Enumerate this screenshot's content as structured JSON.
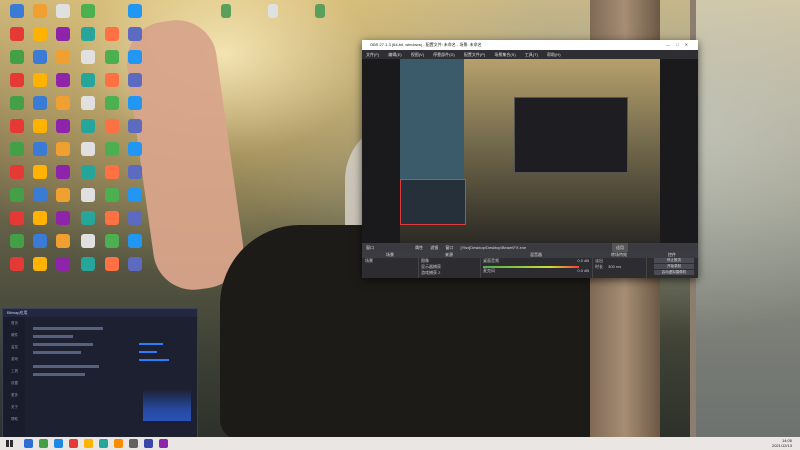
{
  "desktop_icons": [
    {
      "label": "",
      "color": "#3a7bd5"
    },
    {
      "label": "",
      "color": "#f0a030"
    },
    {
      "label": "",
      "color": "#e0e0e0"
    },
    {
      "label": "",
      "color": "#4caf50"
    },
    {
      "label": "",
      "color": "#2196f3"
    },
    {
      "label": "",
      "color": "#e53935"
    },
    {
      "label": "",
      "color": "#ffb300"
    },
    {
      "label": "",
      "color": "#8e24aa"
    },
    {
      "label": "",
      "color": "#26a69a"
    },
    {
      "label": "",
      "color": "#ff7043"
    },
    {
      "label": "",
      "color": "#5c6bc0"
    },
    {
      "label": "",
      "color": "#43a047"
    }
  ],
  "top_files": [
    {
      "label": "",
      "color": "#5aa05a"
    },
    {
      "label": "",
      "color": "#e0e0e0"
    },
    {
      "label": "",
      "color": "#5aa05a"
    }
  ],
  "obs": {
    "title": "OBS 27.1.3 (64-bit, windows) - 配置文件: 未命名 - 场景: 未命名",
    "menu": [
      "文件(F)",
      "编辑(E)",
      "视图(V)",
      "停靠部件(D)",
      "配置文件(P)",
      "场景集合(S)",
      "工具(T)",
      "帮助(H)"
    ],
    "source_bar": {
      "label": "窗口",
      "prop": "属性",
      "filter": "滤镜",
      "window_label": "窗口",
      "window_value": "[Ylsv]Desktop\\Desktop\\Beam\\FX.exe",
      "btn": "适用"
    },
    "panels": {
      "scenes_header": "场景",
      "scenes": [
        "场景"
      ],
      "sources_header": "来源",
      "sources": [
        "图像",
        "显示器捕获",
        "游戏捕获 2"
      ],
      "mixer_header": "混音器",
      "mixer": [
        {
          "name": "桌面音频",
          "value": "0.0 dB"
        },
        {
          "name": "麦克风",
          "value": "0.0 dB"
        }
      ],
      "transitions_header": "转场特效",
      "transition_type": "淡出",
      "duration_label": "时长",
      "duration": "300 ms",
      "controls_header": "控件",
      "controls": [
        "停止推流",
        "开始录制",
        "启动虚拟摄像机",
        "工作室模式",
        "设置",
        "退出"
      ]
    },
    "status": "LIVE: 00:00:00  REC: 00:00:00  CPU: 3.1%, 30.00 fps"
  },
  "dash": {
    "title": "Bitmap应用",
    "side": [
      "首页",
      "硬件",
      "监控",
      "游戏",
      "工具",
      "设置",
      "更多",
      "关于",
      "帮助"
    ]
  },
  "taskbar": {
    "time": "14:05",
    "date": "2021/12/13",
    "icons": [
      "#2b6fd6",
      "#43a047",
      "#1e88e5",
      "#e53935",
      "#ffb300",
      "#26a69a",
      "#fb8c00",
      "#616161",
      "#3949ab",
      "#8e24aa"
    ]
  }
}
